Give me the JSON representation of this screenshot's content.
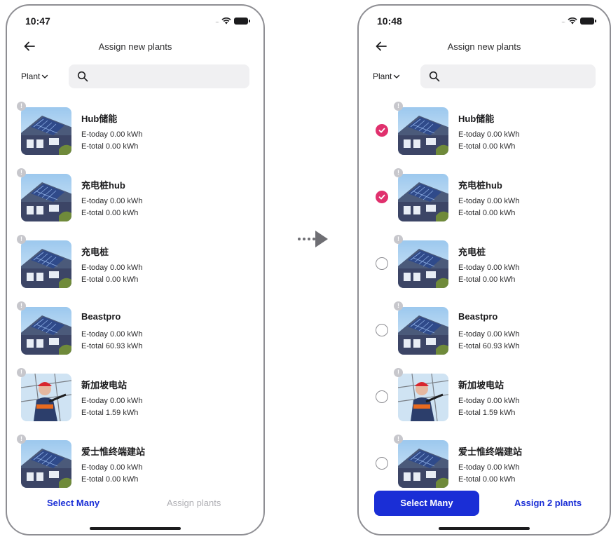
{
  "left": {
    "time": "10:47",
    "title": "Assign new plants",
    "filter_label": "Plant",
    "select_many_label": "Select Many",
    "assign_label": "Assign plants"
  },
  "right": {
    "time": "10:48",
    "title": "Assign new plants",
    "filter_label": "Plant",
    "select_many_label": "Select Many",
    "assign_label": "Assign 2 plants"
  },
  "plants": [
    {
      "name": "Hub储能",
      "e_today": "E-today 0.00 kWh",
      "e_total": "E-total 0.00 kWh",
      "image": "solar-house",
      "selected": true
    },
    {
      "name": "充电桩hub",
      "e_today": "E-today 0.00 kWh",
      "e_total": "E-total 0.00 kWh",
      "image": "solar-house",
      "selected": true
    },
    {
      "name": "充电桩",
      "e_today": "E-today 0.00 kWh",
      "e_total": "E-total 0.00 kWh",
      "image": "solar-house",
      "selected": false
    },
    {
      "name": "Beastpro",
      "e_today": "E-today 0.00 kWh",
      "e_total": "E-total 60.93 kWh",
      "image": "solar-house",
      "selected": false
    },
    {
      "name": "新加坡电站",
      "e_today": "E-today 0.00 kWh",
      "e_total": "E-total 1.59 kWh",
      "image": "worker",
      "selected": false
    },
    {
      "name": "爱士惟终端建站",
      "e_today": "E-today 0.00 kWh",
      "e_total": "E-total 0.00 kWh",
      "image": "solar-house",
      "selected": false
    }
  ],
  "colors": {
    "accent": "#1a2ed6",
    "check": "#e0306d",
    "disabled": "#b0b0b5",
    "search_bg": "#f0f0f2"
  },
  "icons": [
    "back-arrow-icon",
    "chevron-down-icon",
    "search-icon",
    "warning-icon",
    "wifi-icon",
    "battery-icon",
    "check-icon",
    "transition-arrow-icon"
  ]
}
